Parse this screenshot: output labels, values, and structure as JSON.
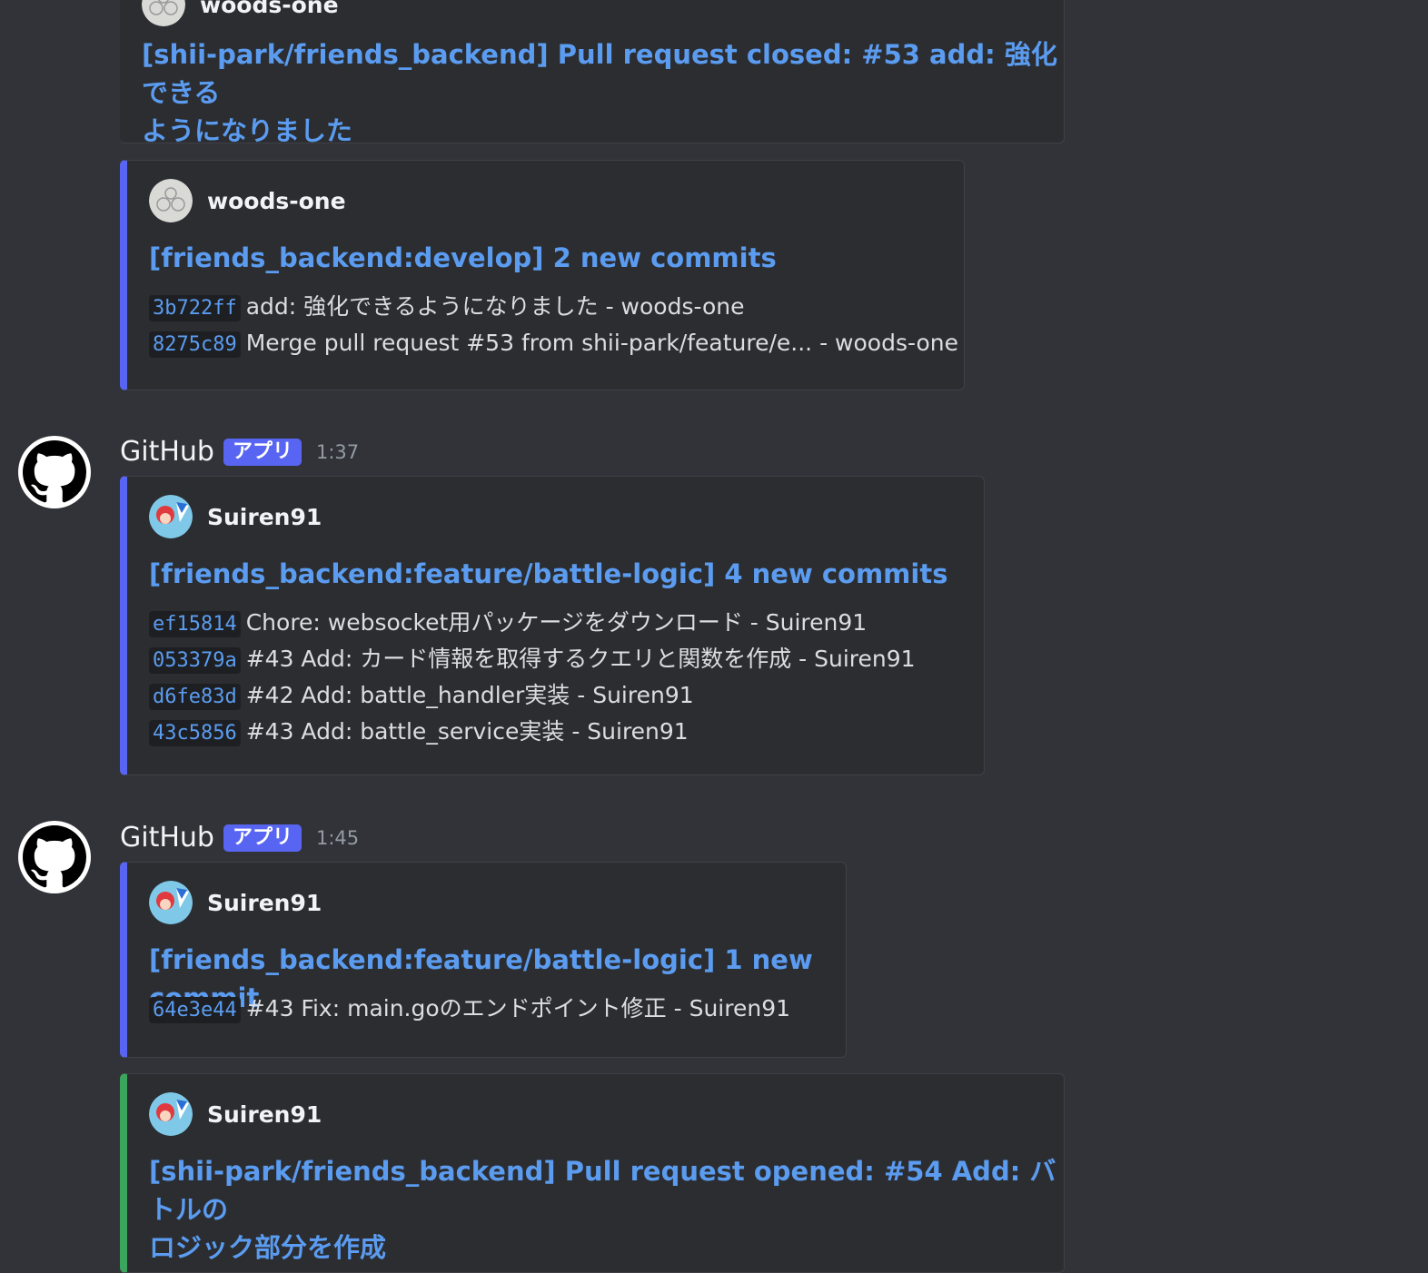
{
  "embeds": [
    {
      "author": "woods-one",
      "title": "[shii-park/friends_backend] Pull request closed: #53 add: 強化できる",
      "title_line2": "ようになりました",
      "commits": []
    },
    {
      "author": "woods-one",
      "title": "[friends_backend:develop] 2 new commits",
      "commits": [
        {
          "hash": "3b722ff",
          "message": "add: 強化できるようになりました - woods-one"
        },
        {
          "hash": "8275c89",
          "message": "Merge pull request #53 from shii-park/feature/e... - woods-one"
        }
      ]
    },
    {
      "author": "Suiren91",
      "title": "[friends_backend:feature/battle-logic] 4 new commits",
      "commits": [
        {
          "hash": "ef15814",
          "message": "Chore: websocket用パッケージをダウンロード - Suiren91"
        },
        {
          "hash": "053379a",
          "message": "#43 Add: カード情報を取得するクエリと関数を作成 - Suiren91"
        },
        {
          "hash": "d6fe83d",
          "message": "#42 Add: battle_handler実装 - Suiren91"
        },
        {
          "hash": "43c5856",
          "message": "#43 Add: battle_service実装 - Suiren91"
        }
      ]
    },
    {
      "author": "Suiren91",
      "title": "[friends_backend:feature/battle-logic] 1 new commit",
      "commits": [
        {
          "hash": "64e3e44",
          "message": "#43 Fix: main.goのエンドポイント修正 - Suiren91"
        }
      ]
    },
    {
      "author": "Suiren91",
      "title": "[shii-park/friends_backend] Pull request opened: #54 Add: バトルの",
      "title_line2": "ロジック部分を作成",
      "commits": []
    }
  ],
  "messages": [
    {
      "bot_name": "GitHub",
      "badge": "アプリ",
      "time": "1:37"
    },
    {
      "bot_name": "GitHub",
      "badge": "アプリ",
      "time": "1:45"
    }
  ],
  "colors": {
    "background": "#313338",
    "embed_background": "#2b2d31",
    "link": "#5b9cf0",
    "commit_bar": "#5865f2",
    "pr_opened_bar": "#3ba55d",
    "badge": "#5865f2"
  }
}
